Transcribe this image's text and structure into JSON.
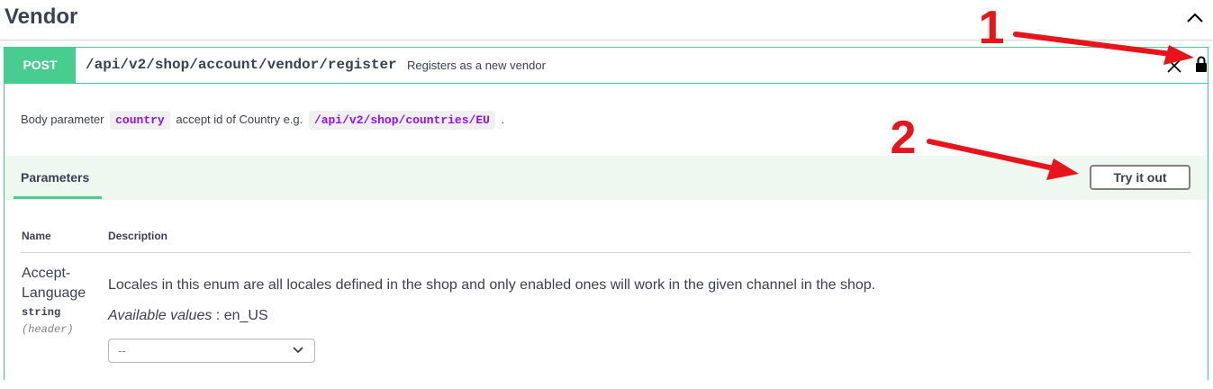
{
  "tag": {
    "title": "Vendor"
  },
  "operation": {
    "method": "POST",
    "path": "/api/v2/shop/account/vendor/register",
    "summary": "Registers as a new vendor",
    "description": {
      "prefix": "Body parameter",
      "param_code": "country",
      "middle": "accept id of Country e.g.",
      "example_code": "/api/v2/shop/countries/EU",
      "suffix": "."
    }
  },
  "parameters_section": {
    "tab_label": "Parameters",
    "try_button_label": "Try it out",
    "columns": {
      "name": "Name",
      "description": "Description"
    },
    "params": [
      {
        "name": "Accept-Language",
        "type": "string",
        "in": "(header)",
        "description": "Locales in this enum are all locales defined in the shop and only enabled ones will work in the given channel in the shop.",
        "available_label": "Available values",
        "available_values": ": en_US",
        "select_value": "--"
      }
    ]
  },
  "annotations": {
    "first": "1",
    "second": "2",
    "arrow_color": "#e8141b"
  },
  "colors": {
    "post_green": "#49cc90",
    "code_purple": "#9012fe",
    "text": "#3b4151"
  },
  "icons": [
    "chevron-up-icon",
    "close-icon",
    "lock-icon",
    "chevron-down-icon"
  ]
}
